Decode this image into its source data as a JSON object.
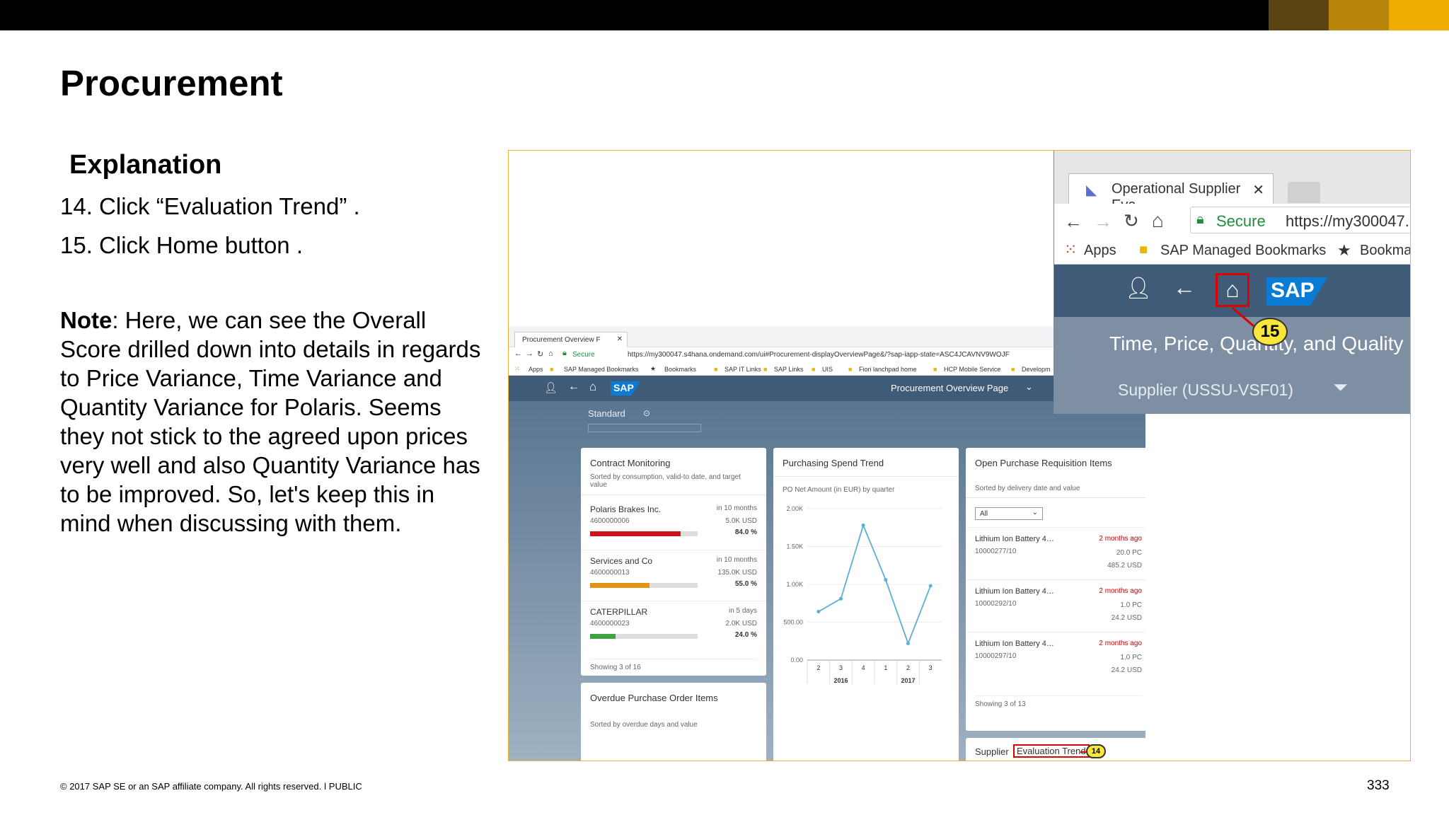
{
  "slide": {
    "title": "Procurement",
    "explanation_heading": "Explanation",
    "step_14": "14. Click “Evaluation Trend” .",
    "step_15": "15. Click Home button .",
    "note_label": "Note",
    "note_text": ": Here, we can see the Overall Score drilled down into details in regards to Price Variance, Time Variance and Quantity Variance for Polaris. Seems they not stick to the agreed upon prices very well and also Quantity Variance has to be improved. So, let's keep this in mind when discussing with them.",
    "copyright": "© 2017 SAP SE or an SAP affiliate company. All rights reserved.  ǀ  PUBLIC",
    "page_number": "333",
    "colors": {
      "gold1": "#5a4411",
      "gold2": "#b8860b",
      "gold3": "#f0ab00",
      "frame": "#e8b23a"
    }
  },
  "browser": {
    "tab_title": "Procurement Overview F",
    "secure": "Secure",
    "url": "https://my300047.s4hana.ondemand.com/ui#Procurement-displayOverviewPage&/?sap-iapp-state=ASC4JCAVNV9WOJF",
    "bookmarks": [
      "Apps",
      "SAP Managed Bookmarks",
      "Bookmarks",
      "SAP IT Links",
      "SAP Links",
      "UIS",
      "Fiori lanchpad home",
      "HCP Mobile Service",
      "Developm"
    ]
  },
  "shell": {
    "logo": "SAP",
    "app_title": "Procurement Overview Page",
    "variant": "Standard",
    "user_icon": "user-icon",
    "back_icon": "back-arrow-icon",
    "home_icon": "home-icon"
  },
  "cards": {
    "contract": {
      "title": "Contract Monitoring",
      "subtitle": "Sorted by consumption, valid-to date, and target value",
      "rows": [
        {
          "name": "Polaris Brakes Inc.",
          "id": "4600000006",
          "period": "in 10 months",
          "value": "5.0K USD",
          "pct": "84.0 %",
          "fill": 0.84,
          "color": "#d0141d"
        },
        {
          "name": "Services and Co",
          "id": "4600000013",
          "period": "in 10 months",
          "value": "135.0K USD",
          "pct": "55.0 %",
          "fill": 0.55,
          "color": "#e09410"
        },
        {
          "name": "CATERPILLAR",
          "id": "4600000023",
          "period": "in 5 days",
          "value": "2.0K USD",
          "pct": "24.0 %",
          "fill": 0.24,
          "color": "#3ea23e"
        }
      ],
      "footer": "Showing 3 of 16"
    },
    "spend": {
      "title": "Purchasing Spend Trend",
      "subtitle": "PO Net Amount (in EUR) by quarter"
    },
    "requisition": {
      "title": "Open Purchase Requisition Items",
      "subtitle": "Sorted by delivery date and value",
      "filter": "All",
      "rows": [
        {
          "name": "Lithium Ion Battery 4…",
          "id": "10000277/10",
          "age": "2 months ago",
          "qty": "20.0 PC",
          "value": "485.2 USD"
        },
        {
          "name": "Lithium Ion Battery 4…",
          "id": "10000292/10",
          "age": "2 months ago",
          "qty": "1.0 PC",
          "value": "24.2 USD"
        },
        {
          "name": "Lithium Ion Battery 4…",
          "id": "10000297/10",
          "age": "2 months ago",
          "qty": "1.0 PC",
          "value": "24.2 USD"
        }
      ],
      "footer": "Showing 3 of 13"
    },
    "overdue": {
      "title": "Overdue Purchase Order Items",
      "subtitle": "Sorted by overdue days and value"
    },
    "supplier": {
      "prefix": "Supplier",
      "link": "Evaluation Trend",
      "callout": "14"
    }
  },
  "chart_data": {
    "type": "line",
    "title": "Purchasing Spend Trend",
    "subtitle": "PO Net Amount (in EUR) by quarter",
    "x": [
      "2",
      "3",
      "4",
      "1",
      "2",
      "3"
    ],
    "x_groups": [
      {
        "label": "2016",
        "span": 3
      },
      {
        "label": "2017",
        "span": 3
      }
    ],
    "series": [
      {
        "values": [
          640,
          810,
          1780,
          1060,
          220,
          980
        ]
      }
    ],
    "yticks": [
      "2.00K",
      "1.50K",
      "1.00K",
      "500.00",
      "0.00"
    ],
    "ylim": [
      0,
      2000
    ],
    "line_color": "#5aaed8"
  },
  "zoom": {
    "tab_title": "Operational Supplier Eva",
    "secure": "Secure",
    "url": "https://my300047.",
    "bookmarks": [
      "Apps",
      "SAP Managed Bookmarks",
      "Bookmar"
    ],
    "logo": "SAP",
    "header_text": "Time, Price, Quantity, and Quality",
    "supplier_text": "Supplier (USSU-VSF01)",
    "callout": "15"
  }
}
